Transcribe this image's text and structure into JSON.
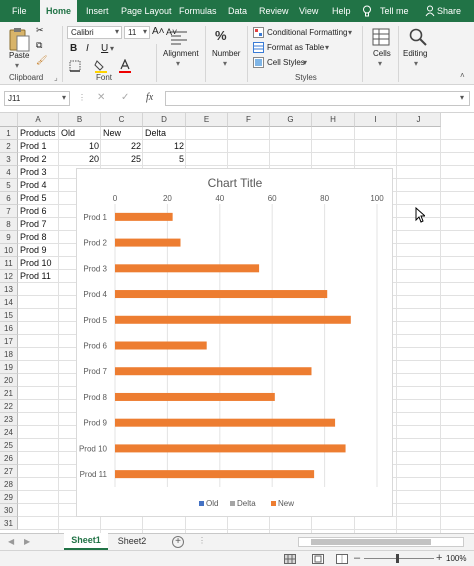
{
  "ribbon_tabs": [
    "File",
    "Home",
    "Insert",
    "Page Layout",
    "Formulas",
    "Data",
    "Review",
    "View",
    "Help"
  ],
  "tell_me": "Tell me",
  "share": "Share",
  "clipboard": {
    "paste": "Paste",
    "label": "Clipboard"
  },
  "font": {
    "name": "Calibri",
    "size": "11",
    "bold": "B",
    "italic": "I",
    "underline": "U",
    "grow": "A",
    "shrink": "A",
    "label": "Font"
  },
  "alignment": {
    "label": "Alignment"
  },
  "number": {
    "label": "Number"
  },
  "styles": {
    "conditional": "Conditional Formatting",
    "table": "Format as Table",
    "cell_styles": "Cell Styles",
    "label": "Styles"
  },
  "cells": {
    "label": "Cells"
  },
  "editing": {
    "label": "Editing"
  },
  "formula_bar": {
    "name_box": "J11",
    "fx": "fx",
    "value": ""
  },
  "columns": [
    "A",
    "B",
    "C",
    "D",
    "E",
    "F",
    "G",
    "H",
    "I",
    "J"
  ],
  "rows": [
    "1",
    "2",
    "3",
    "4",
    "5",
    "6",
    "7",
    "8",
    "9",
    "10",
    "11",
    "12",
    "13",
    "14",
    "15",
    "16",
    "17",
    "18",
    "19",
    "20",
    "21",
    "22",
    "23",
    "24",
    "25",
    "26",
    "27",
    "28",
    "29",
    "30",
    "31"
  ],
  "cells_data": {
    "A1": "Products",
    "B1": "Old",
    "C1": "New",
    "D1": "Delta",
    "A2": "Prod 1",
    "B2": "10",
    "C2": "22",
    "D2": "12",
    "A3": "Prod 2",
    "B3": "20",
    "C3": "25",
    "D3": "5",
    "A4": "Prod 3",
    "A5": "Prod 4",
    "A6": "Prod 5",
    "A7": "Prod 6",
    "A8": "Prod 7",
    "A9": "Prod 8",
    "A10": "Prod 9",
    "A11": "Prod 10",
    "A12": "Prod 11"
  },
  "chart_data": {
    "type": "bar",
    "title": "Chart Title",
    "categories": [
      "Prod 1",
      "Prod 2",
      "Prod 3",
      "Prod 4",
      "Prod 5",
      "Prod 6",
      "Prod 7",
      "Prod 8",
      "Prod 9",
      "Prod 10",
      "Prod 11"
    ],
    "series": [
      {
        "name": "Old",
        "values": [],
        "color": "#4472c4"
      },
      {
        "name": "Delta",
        "values": [],
        "color": "#a5a5a5"
      },
      {
        "name": "New",
        "values": [
          22,
          25,
          55,
          81,
          90,
          35,
          75,
          61,
          84,
          88,
          76
        ],
        "color": "#ed7d31"
      }
    ],
    "xlim": [
      0,
      100
    ],
    "xticks": [
      0,
      20,
      40,
      60,
      80,
      100
    ],
    "legend": "bottom",
    "grid": true
  },
  "sheets": [
    "Sheet1",
    "Sheet2"
  ],
  "zoom": "100%",
  "colors": {
    "brand": "#217346",
    "new": "#ed7d31",
    "old": "#4472c4",
    "delta": "#a5a5a5"
  }
}
